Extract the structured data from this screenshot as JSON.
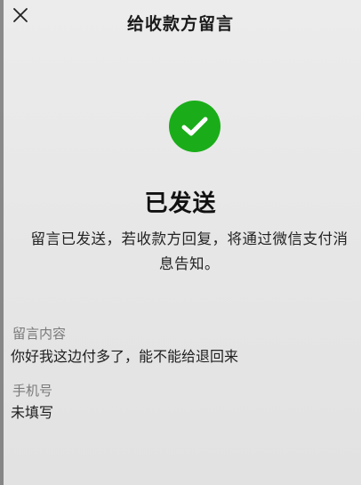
{
  "header": {
    "title": "给收款方留言",
    "close_icon": "close-icon"
  },
  "status": {
    "icon": "check-circle-icon",
    "icon_color": "#1aad19",
    "headline": "已发送",
    "description": "留言已发送，若收款方回复，将通过微信支付消息告知。"
  },
  "fields": {
    "message": {
      "label": "留言内容",
      "value": "你好我这边付多了，能不能给退回来"
    },
    "phone": {
      "label": "手机号",
      "value": "未填写"
    }
  }
}
